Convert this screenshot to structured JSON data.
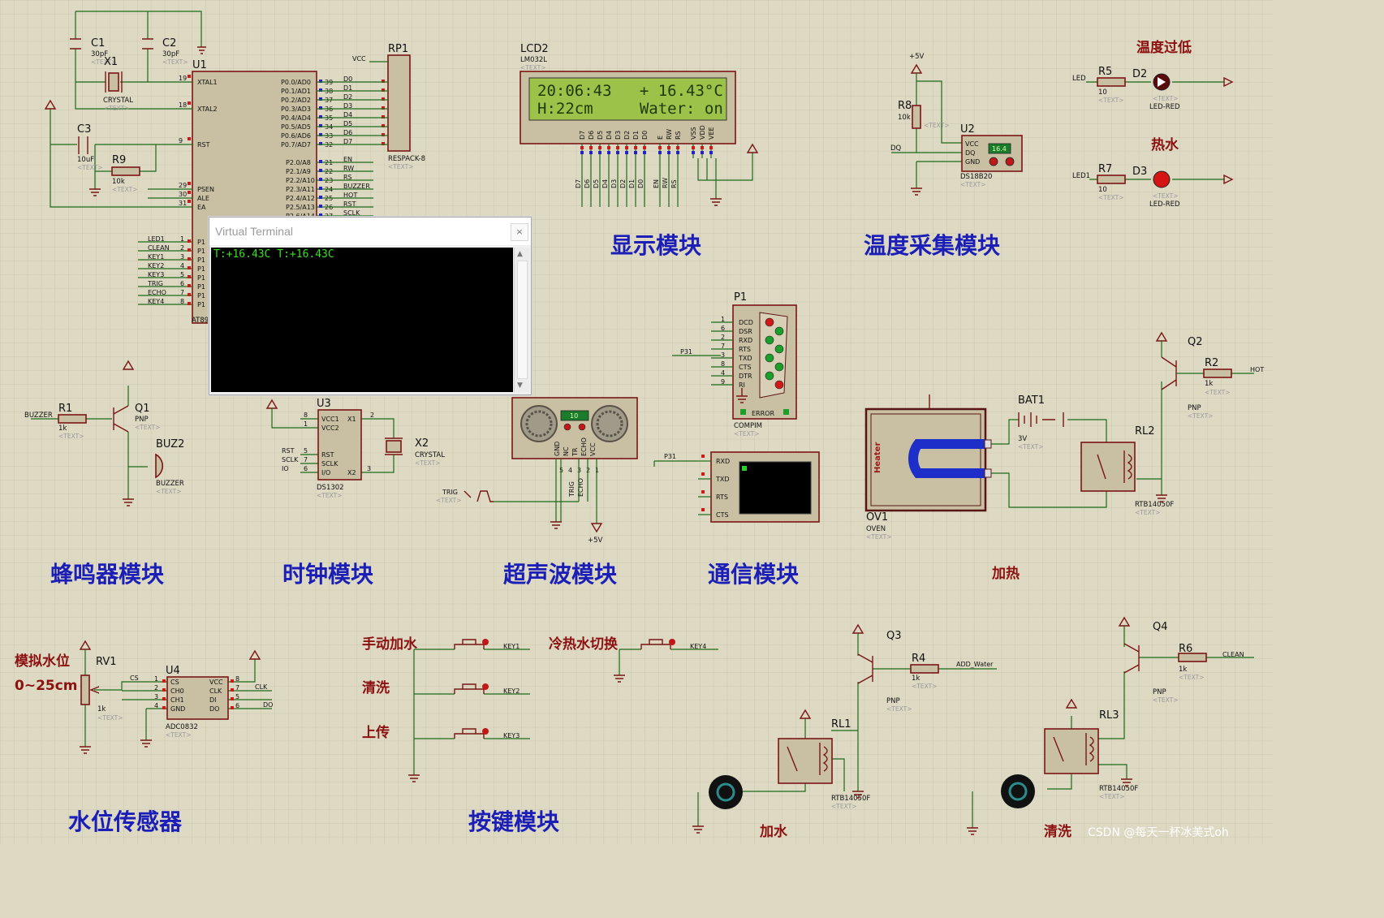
{
  "modules": {
    "display": "显示模块",
    "temperature": "温度采集模块",
    "buzzer": "蜂鸣器模块",
    "clock": "时钟模块",
    "ultrasonic": "超声波模块",
    "comm": "通信模块",
    "heating": "加热",
    "water_sensor": "水位传感器",
    "keys": "按键模块",
    "add_water": "加水",
    "clean": "清洗"
  },
  "notes": {
    "overtemp": "温度过低",
    "hotwater": "热水",
    "sim_level": "模拟水位",
    "level_range": "0~25cm",
    "manual_add": "手动加水",
    "wash": "清洗",
    "upload": "上传",
    "switch_water": "冷热水切换"
  },
  "lcd": {
    "ref": "LCD2",
    "model": "LM032L",
    "line1": "20:06:43   + 16.43°C",
    "line2": "H:22cm     Water: on",
    "pins": [
      "D7",
      "D6",
      "D5",
      "D4",
      "D3",
      "D2",
      "D1",
      "D0",
      "E",
      "RW",
      "RS",
      "VSS",
      "VDD",
      "VEE"
    ],
    "bus": [
      "D7",
      "D6",
      "D5",
      "D4",
      "D3",
      "D2",
      "D1",
      "D0",
      "EN",
      "RW",
      "RS"
    ]
  },
  "mcu": {
    "ref": "U1",
    "model": "AT89C51",
    "left_pins": [
      {
        "n": "19",
        "name": "XTAL1"
      },
      {
        "n": "18",
        "name": "XTAL2"
      },
      {
        "n": "9",
        "name": "RST"
      },
      {
        "n": "29",
        "name": "PSEN"
      },
      {
        "n": "30",
        "name": "ALE"
      },
      {
        "n": "31",
        "name": "EA"
      }
    ],
    "p0_pins": [
      {
        "n": "39",
        "name": "P0.0/AD0",
        "net": "D0"
      },
      {
        "n": "38",
        "name": "P0.1/AD1",
        "net": "D1"
      },
      {
        "n": "37",
        "name": "P0.2/AD2",
        "net": "D2"
      },
      {
        "n": "36",
        "name": "P0.3/AD3",
        "net": "D3"
      },
      {
        "n": "35",
        "name": "P0.4/AD4",
        "net": "D4"
      },
      {
        "n": "34",
        "name": "P0.5/AD5",
        "net": "D5"
      },
      {
        "n": "33",
        "name": "P0.6/AD6",
        "net": "D6"
      },
      {
        "n": "32",
        "name": "P0.7/AD7",
        "net": "D7"
      }
    ],
    "p2_pins": [
      {
        "n": "21",
        "name": "P2.0/A8",
        "net": "EN"
      },
      {
        "n": "22",
        "name": "P2.1/A9",
        "net": "RW"
      },
      {
        "n": "23",
        "name": "P2.2/A10",
        "net": "RS"
      },
      {
        "n": "24",
        "name": "P2.3/A11",
        "net": "BUZZER"
      },
      {
        "n": "25",
        "name": "P2.4/A12",
        "net": "HOT"
      },
      {
        "n": "26",
        "name": "P2.5/A13",
        "net": "RST"
      },
      {
        "n": "27",
        "name": "P2.6/A14",
        "net": "SCLK"
      }
    ],
    "p1_nets": [
      {
        "n": "1",
        "net": "LED1"
      },
      {
        "n": "2",
        "net": "CLEAN"
      },
      {
        "n": "3",
        "net": "KEY1"
      },
      {
        "n": "4",
        "net": "KEY2"
      },
      {
        "n": "5",
        "net": "KEY3"
      },
      {
        "n": "6",
        "net": "TRIG"
      },
      {
        "n": "7",
        "net": "ECHO"
      },
      {
        "n": "8",
        "net": "KEY4"
      }
    ]
  },
  "passives": {
    "C1": {
      "ref": "C1",
      "val": "30pF"
    },
    "C2": {
      "ref": "C2",
      "val": "30pF"
    },
    "X1": {
      "ref": "X1",
      "val": "CRYSTAL"
    },
    "C3": {
      "ref": "C3",
      "val": "10uF"
    },
    "R9": {
      "ref": "R9",
      "val": "10k"
    },
    "RP1": {
      "ref": "RP1",
      "val": "RESPACK-8",
      "vcc": "VCC"
    },
    "R1": {
      "ref": "R1",
      "val": "1k",
      "net": "BUZZER"
    },
    "Q1": {
      "ref": "Q1",
      "val": "PNP"
    },
    "BUZ2": {
      "ref": "BUZ2",
      "val": "BUZZER"
    },
    "R5": {
      "ref": "R5",
      "val": "10",
      "net": "LED"
    },
    "D2": {
      "ref": "D2",
      "val": "LED-RED"
    },
    "R7": {
      "ref": "R7",
      "val": "10",
      "net": "LED1"
    },
    "D3": {
      "ref": "D3",
      "val": "LED-RED"
    },
    "R8": {
      "ref": "R8",
      "val": "10k",
      "supply": "+5V"
    },
    "Q2": {
      "ref": "Q2",
      "val": "PNP"
    },
    "R2": {
      "ref": "R2",
      "val": "1k",
      "net": "HOT"
    },
    "BAT1": {
      "ref": "BAT1",
      "val": "3V"
    },
    "RL2": {
      "ref": "RL2",
      "val": "RTB14050F"
    },
    "OV1": {
      "ref": "OV1",
      "val": "OVEN",
      "label": "Heater"
    },
    "RV1": {
      "ref": "RV1",
      "val": "1k"
    },
    "Q3": {
      "ref": "Q3",
      "val": "PNP"
    },
    "R4": {
      "ref": "R4",
      "val": "1k",
      "net": "ADD_Water"
    },
    "RL1": {
      "ref": "RL1",
      "val": "RTB14050F"
    },
    "Q4": {
      "ref": "Q4",
      "val": "PNP"
    },
    "R6": {
      "ref": "R6",
      "val": "1k",
      "net": "CLEAN"
    },
    "RL3": {
      "ref": "RL3",
      "val": "RTB14050F"
    },
    "X2": {
      "ref": "X2",
      "val": "CRYSTAL"
    }
  },
  "ds18b20": {
    "ref": "U2",
    "model": "DS18B20",
    "pins": [
      "VCC",
      "DQ",
      "GND"
    ],
    "reading": "16.4",
    "net": "DQ"
  },
  "ds1302": {
    "ref": "U3",
    "model": "DS1302",
    "left": [
      "VCC1",
      "VCC2",
      "RST",
      "SCLK",
      "I/O"
    ],
    "right": [
      "X1",
      "X2"
    ],
    "nets": [
      "RST",
      "SCLK",
      "IO"
    ],
    "nums": [
      "8",
      "1",
      "5",
      "7",
      "6",
      "2",
      "3"
    ]
  },
  "adc": {
    "ref": "U4",
    "model": "ADC0832",
    "left": [
      "CS",
      "CH0",
      "CH1",
      "GND"
    ],
    "right": [
      "VCC",
      "CLK",
      "DI",
      "DO"
    ],
    "nets": [
      "CS",
      "CLK",
      "DO"
    ],
    "nums": [
      "1",
      "2",
      "3",
      "4",
      "8",
      "7",
      "5",
      "6"
    ]
  },
  "compim": {
    "ref": "P1",
    "model": "COMPIM",
    "pins": [
      "DCD",
      "DSR",
      "RXD",
      "RTS",
      "TXD",
      "CTS",
      "DTR",
      "RI"
    ],
    "nums": [
      "1",
      "6",
      "2",
      "7",
      "3",
      "8",
      "4",
      "9"
    ],
    "net": "P31",
    "error": "ERROR"
  },
  "sonar": {
    "pins": [
      "GND",
      "NC",
      "TR",
      "ECHO",
      "VCC"
    ],
    "nums": [
      "5",
      "4",
      "3",
      "2",
      "1"
    ],
    "reading": "10",
    "nets": [
      "TRIG",
      "ECHO"
    ],
    "supply": "+5V",
    "trig": "TRIG"
  },
  "vterm2": {
    "pins": [
      "RXD",
      "TXD",
      "RTS",
      "CTS"
    ],
    "net": "P31"
  },
  "keys": {
    "key1": "KEY1",
    "key2": "KEY2",
    "key3": "KEY3",
    "key4": "KEY4"
  },
  "text_placeholder": "<TEXT>",
  "vt": {
    "title": "Virtual Terminal",
    "close": "×",
    "output": "T:+16.43C T:+16.43C",
    "p0_ghost": "P1",
    "mcu_partial": "AT89"
  },
  "watermark": "CSDN @每天一杯冰美式oh",
  "colors": {
    "background": "#ddd9c3",
    "wire": "#1c6b1c",
    "component": "#7a1515",
    "module_label": "#1b1fb8",
    "note_label": "#8c1010",
    "lcd_bg": "#9cc24a",
    "terminal_text": "#39e01f"
  }
}
